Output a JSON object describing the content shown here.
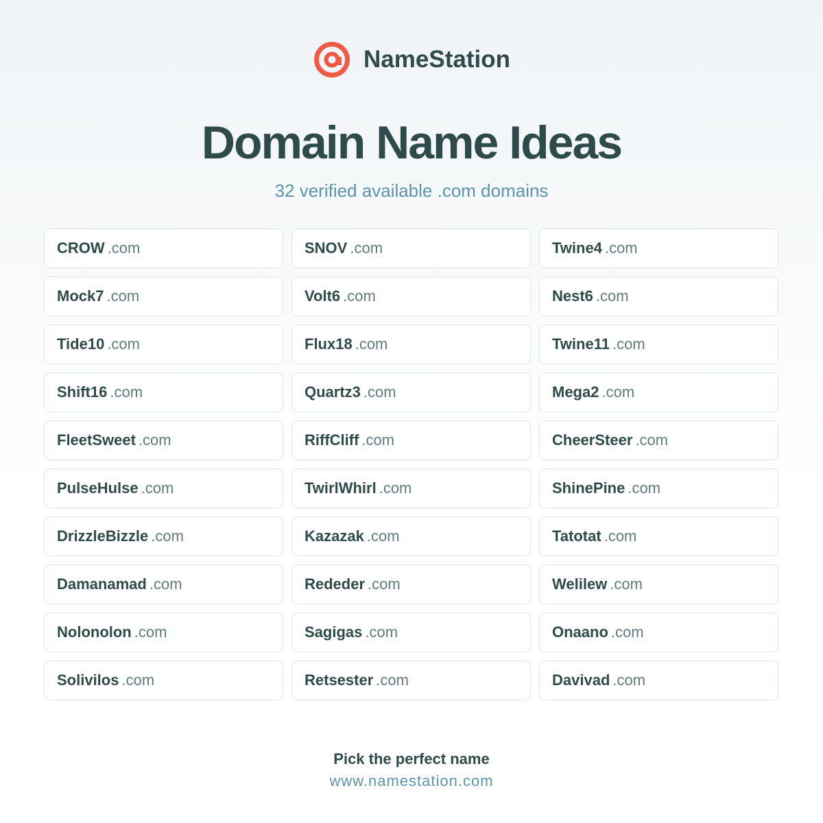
{
  "brand": {
    "name": "NameStation",
    "logo_icon": "target-at-icon",
    "logo_color": "#f05a45"
  },
  "header": {
    "title": "Domain Name Ideas",
    "subtitle": "32 verified available .com domains"
  },
  "domains": [
    {
      "name": "CROW",
      "tld": ".com"
    },
    {
      "name": "SNOV",
      "tld": ".com"
    },
    {
      "name": "Twine4",
      "tld": ".com"
    },
    {
      "name": "Mock7",
      "tld": ".com"
    },
    {
      "name": "Volt6",
      "tld": ".com"
    },
    {
      "name": "Nest6",
      "tld": ".com"
    },
    {
      "name": "Tide10",
      "tld": ".com"
    },
    {
      "name": "Flux18",
      "tld": ".com"
    },
    {
      "name": "Twine11",
      "tld": ".com"
    },
    {
      "name": "Shift16",
      "tld": ".com"
    },
    {
      "name": "Quartz3",
      "tld": ".com"
    },
    {
      "name": "Mega2",
      "tld": ".com"
    },
    {
      "name": "FleetSweet",
      "tld": ".com"
    },
    {
      "name": "RiffCliff",
      "tld": ".com"
    },
    {
      "name": "CheerSteer",
      "tld": ".com"
    },
    {
      "name": "PulseHulse",
      "tld": ".com"
    },
    {
      "name": "TwirlWhirl",
      "tld": ".com"
    },
    {
      "name": "ShinePine",
      "tld": ".com"
    },
    {
      "name": "DrizzleBizzle",
      "tld": ".com"
    },
    {
      "name": "Kazazak",
      "tld": ".com"
    },
    {
      "name": "Tatotat",
      "tld": ".com"
    },
    {
      "name": "Damanamad",
      "tld": ".com"
    },
    {
      "name": "Rededer",
      "tld": ".com"
    },
    {
      "name": "Welilew",
      "tld": ".com"
    },
    {
      "name": "Nolonolon",
      "tld": ".com"
    },
    {
      "name": "Sagigas",
      "tld": ".com"
    },
    {
      "name": "Onaano",
      "tld": ".com"
    },
    {
      "name": "Solivilos",
      "tld": ".com"
    },
    {
      "name": "Retsester",
      "tld": ".com"
    },
    {
      "name": "Davivad",
      "tld": ".com"
    }
  ],
  "footer": {
    "tagline": "Pick the perfect name",
    "url": "www.namestation.com"
  },
  "colors": {
    "text_dark": "#2f4a4a",
    "accent_teal": "#5b95aa",
    "tld_gray": "#5f7a80",
    "card_border": "#dfe6ea"
  }
}
